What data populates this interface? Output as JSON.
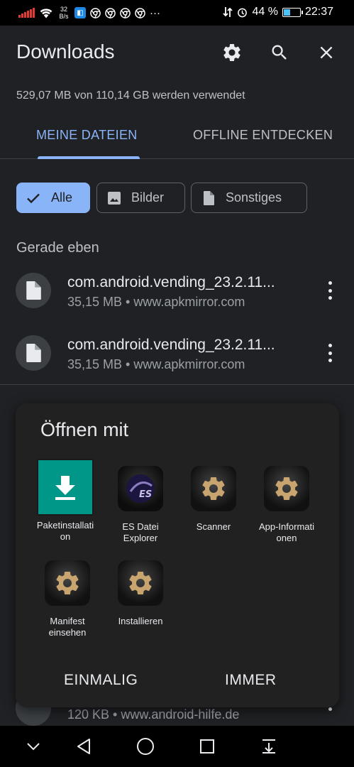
{
  "status_bar": {
    "net_speed_value": "32",
    "net_speed_unit": "B/s",
    "battery_percent_text": "44 %",
    "battery_level": 0.44,
    "time": "22:37",
    "more_indicator": "···"
  },
  "header": {
    "title": "Downloads",
    "settings_icon": "gear-icon",
    "search_icon": "search-icon",
    "close_icon": "close-icon"
  },
  "storage_text": "529,07 MB von 110,14 GB werden verwendet",
  "tabs": [
    {
      "label": "MEINE DATEIEN",
      "active": true
    },
    {
      "label": "OFFLINE ENTDECKEN",
      "active": false
    }
  ],
  "chips": [
    {
      "label": "Alle",
      "icon": "check-icon",
      "active": true
    },
    {
      "label": "Bilder",
      "icon": "image-icon",
      "active": false
    },
    {
      "label": "Sonstiges",
      "icon": "file-icon",
      "active": false
    }
  ],
  "section_label": "Gerade eben",
  "files": [
    {
      "name": "com.android.vending_23.2.11...",
      "size": "35,15 MB",
      "source": "www.apkmirror.com",
      "meta": "35,15 MB • www.apkmirror.com"
    },
    {
      "name": "com.android.vending_23.2.11...",
      "size": "35,15 MB",
      "source": "www.apkmirror.com",
      "meta": "35,15 MB • www.apkmirror.com"
    }
  ],
  "peek_file": {
    "meta": "120 KB • www.android-hilfe.de"
  },
  "dialog": {
    "title": "Öffnen mit",
    "apps": [
      {
        "label": "Paketinstallati on",
        "line1": "Paketinstallati",
        "line2": "on",
        "icon": "download-icon"
      },
      {
        "label": "ES Datei Explorer",
        "line1": "ES Datei",
        "line2": "Explorer",
        "icon": "es-explorer-icon"
      },
      {
        "label": "Scanner",
        "line1": "Scanner",
        "line2": "",
        "icon": "gear-icon"
      },
      {
        "label": "App-Informati onen",
        "line1": "App-Informati",
        "line2": "onen",
        "icon": "gear-icon"
      },
      {
        "label": "Manifest einsehen",
        "line1": "Manifest",
        "line2": "einsehen",
        "icon": "gear-icon"
      },
      {
        "label": "Installieren",
        "line1": "Installieren",
        "line2": "",
        "icon": "gear-icon"
      }
    ],
    "once_label": "EINMALIG",
    "always_label": "IMMER"
  },
  "colors": {
    "background": "#202124",
    "accent": "#8ab4f8",
    "installer_teal": "#009688",
    "dialog_bg": "#212121"
  }
}
